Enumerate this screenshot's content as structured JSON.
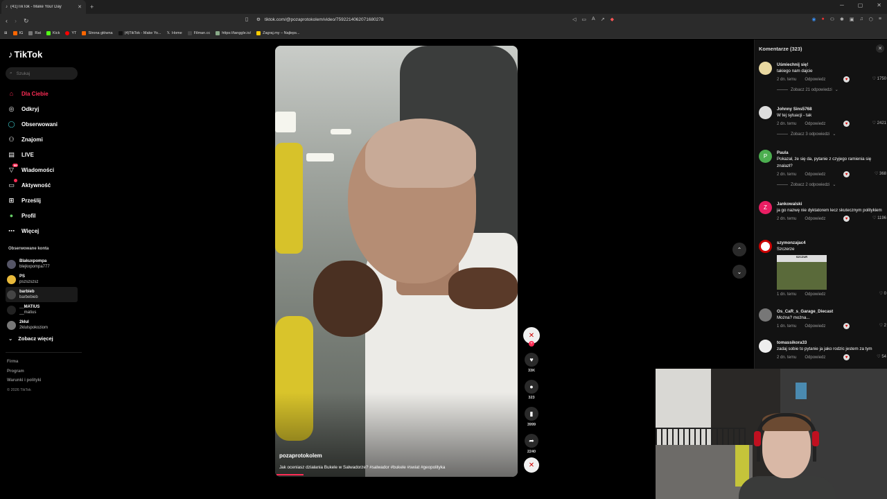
{
  "browser": {
    "tab_title": "(41)TikTok - Make Your Day",
    "url": "tiktok.com/@pozaprotokolem/video/7592214062071680278",
    "bookmarks": [
      "IG",
      "Rat",
      "Kick",
      "YT",
      "Strona główna",
      "(4)TikTok - Make Yo...",
      "Home",
      "Filman.cc",
      "https://tanggle.io/",
      "Zagraj.my – Najleps..."
    ]
  },
  "sidebar": {
    "logo": "TikTok",
    "search_placeholder": "Szukaj",
    "nav": [
      {
        "label": "Dla Ciebie",
        "icon": "home-icon",
        "active": true
      },
      {
        "label": "Odkryj",
        "icon": "compass-icon"
      },
      {
        "label": "Obserwowani",
        "icon": "following-icon"
      },
      {
        "label": "Znajomi",
        "icon": "friends-icon"
      },
      {
        "label": "LIVE",
        "icon": "live-icon"
      },
      {
        "label": "Wiadomości",
        "icon": "messages-icon",
        "badge": "99"
      },
      {
        "label": "Aktywność",
        "icon": "activity-icon",
        "badge": ""
      },
      {
        "label": "Prześlij",
        "icon": "upload-icon"
      },
      {
        "label": "Profil",
        "icon": "profile-icon"
      },
      {
        "label": "Więcej",
        "icon": "more-icon"
      }
    ],
    "followed_title": "Obserwowane konta",
    "followed": [
      {
        "name": "Blakuxpompa",
        "handle": "blejkxpompa777"
      },
      {
        "name": "PS",
        "handle": "pszszszsz"
      },
      {
        "name": "barbieb",
        "handle": "barbebieb"
      },
      {
        "name": "__MATIUS",
        "handle": "__matius"
      },
      {
        "name": "2kłul",
        "handle": "2klulspokoziom"
      }
    ],
    "see_more": "Zobacz więcej",
    "footer": [
      "Firma",
      "Program",
      "Warunki i polityki"
    ],
    "copyright": "© 2026 TikTok"
  },
  "video": {
    "author": "pozaprotokolem",
    "description": "Jak oceniasz działania Bukele w Salwadorze? #salwador #bukele #swiat #geopolityka",
    "likes": "33K",
    "comments": "323",
    "saves": "3999",
    "shares": "2240",
    "progress": 0.11
  },
  "comments_panel": {
    "title": "Komentarze (323)",
    "items": [
      {
        "user": "Uśmiechnij się!",
        "text": "takiego nam dajcie",
        "time": "2 dn. temu",
        "reply": "Odpowiedz",
        "likes": "1750",
        "replies": "Zobacz 21 odpowiedzi",
        "avatar_color": "#e8d8a0"
      },
      {
        "user": "Johnny Sins5768",
        "text": "W tej sytuacji - tak",
        "time": "2 dn. temu",
        "reply": "Odpowiedz",
        "likes": "2421",
        "replies": "Zobacz 3 odpowiedzi",
        "avatar_color": "#ddd"
      },
      {
        "user": "Paula",
        "text": "Pokazał, że się da, pytanie z czyjego ramienia się znalazł?",
        "time": "2 dn. temu",
        "reply": "Odpowiedz",
        "likes": "368",
        "replies": "Zobacz 2 odpowiedzi",
        "avatar_color": "#4caf50",
        "avatar_letter": "P"
      },
      {
        "user": "Jankowalski",
        "text": "ja go nazwę nie dyktatorem lecz skutecznym politykiem",
        "time": "2 dn. temu",
        "reply": "Odpowiedz",
        "likes": "1196",
        "replies": "",
        "avatar_color": "#e91e63",
        "avatar_letter": "Z"
      },
      {
        "user": "szymonzajac4",
        "text": "Szczerze",
        "time": "1 dn. temu",
        "reply": "Odpowiedz",
        "likes": "0",
        "replies": "",
        "avatar_color": "#fff",
        "image_caption": "SZCZUR"
      },
      {
        "user": "Os_CaR_s_Garage_Diecast",
        "text": "Można? można...",
        "time": "1 dn. temu",
        "reply": "Odpowiedz",
        "likes": "2",
        "replies": "",
        "avatar_color": "#777"
      },
      {
        "user": "tomassikora33",
        "text": "zadaj sobie to pytanie ja jako rodzic jestem za tym",
        "time": "2 dn. temu",
        "reply": "Odpowiedz",
        "likes": "54",
        "replies": "",
        "avatar_color": "#eee"
      }
    ]
  }
}
